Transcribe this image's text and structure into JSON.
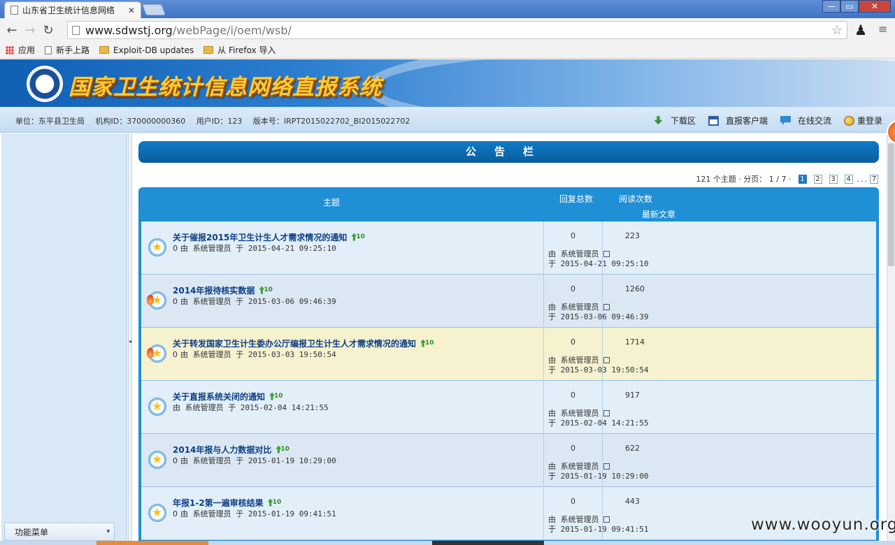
{
  "browser": {
    "tab_title": "山东省卫生统计信息网络",
    "tab_close": "✕",
    "url_host": "www.sdwstj.org",
    "url_path": "/webPage/i/oem/wsb/",
    "back": "←",
    "forward": "→",
    "reload": "↻",
    "star": "☆",
    "chess": "♟",
    "menu": "≡",
    "win_min": "—",
    "win_max": "▭",
    "win_close": "✕",
    "bookmarks": [
      {
        "label": "应用",
        "icon": "apps-icon"
      },
      {
        "label": "新手上路",
        "icon": "doc-icon"
      },
      {
        "label": "Exploit-DB updates",
        "icon": "folder-icon"
      },
      {
        "label": "从 Firefox 导入",
        "icon": "folder-icon"
      }
    ]
  },
  "header": {
    "system_title": "国家卫生统计信息网络直报系统",
    "unit": "单位：东平县卫生局",
    "org_id": "机构ID：370000000360",
    "user_id": "用户ID：123",
    "version": "版本号：IRPT2015022702_BI2015022702",
    "links": {
      "download": "下载区",
      "client": "直报客户端",
      "chat": "在线交流",
      "relogin": "重登录"
    }
  },
  "sidebar": {
    "menu_label": "功能菜单",
    "caret": "▾",
    "grip": "◂"
  },
  "board": {
    "title": "公告栏",
    "pager": {
      "summary": "121 个主题 · 分页： 1 / 7 ·",
      "pages": [
        "1",
        "2",
        "3",
        "4"
      ],
      "ellipsis": "...",
      "last": "7",
      "current": "1"
    },
    "columns": {
      "topic": "主题",
      "replies": "回复总数",
      "reads": "阅读次数",
      "latest": "最新文章"
    },
    "rows": [
      {
        "title": "关于催报2015年卫生计生人才需求情况的通知",
        "clip": "0",
        "byline": "由 系统管理员 于 2015-04-21 09:25:10",
        "replies": "0",
        "reads": "223",
        "latest_by": "由 系统管理员",
        "latest_at": "于 2015-04-21 09:25:10"
      },
      {
        "title": "2014年报待核实数据",
        "clip": "0",
        "byline": "由 系统管理员 于 2015-03-06 09:46:39",
        "replies": "0",
        "reads": "1260",
        "latest_by": "由 系统管理员",
        "latest_at": "于 2015-03-06 09:46:39"
      },
      {
        "title": "关于转发国家卫生计生委办公厅编报卫生计生人才需求情况的通知",
        "clip": "0",
        "byline": "由 系统管理员 于 2015-03-03 19:50:54",
        "replies": "0",
        "reads": "1714",
        "latest_by": "由 系统管理员",
        "latest_at": "于 2015-03-03 19:50:54"
      },
      {
        "title": "关于直报系统关闭的通知",
        "clip": "",
        "byline": "由 系统管理员 于 2015-02-04 14:21:55",
        "replies": "0",
        "reads": "917",
        "latest_by": "由 系统管理员",
        "latest_at": "于 2015-02-04 14:21:55"
      },
      {
        "title": "2014年报与人力数据对比",
        "clip": "0",
        "byline": "由 系统管理员 于 2015-01-19 10:29:00",
        "replies": "0",
        "reads": "622",
        "latest_by": "由 系统管理员",
        "latest_at": "于 2015-01-19 10:29:00"
      },
      {
        "title": "年报1-2第一遍审核结果",
        "clip": "0",
        "byline": "由 系统管理员 于 2015-01-19 09:41:51",
        "replies": "0",
        "reads": "443",
        "latest_by": "由 系统管理员",
        "latest_at": "于 2015-01-19 09:41:51"
      }
    ]
  },
  "watermark": "www.wooyun.org"
}
